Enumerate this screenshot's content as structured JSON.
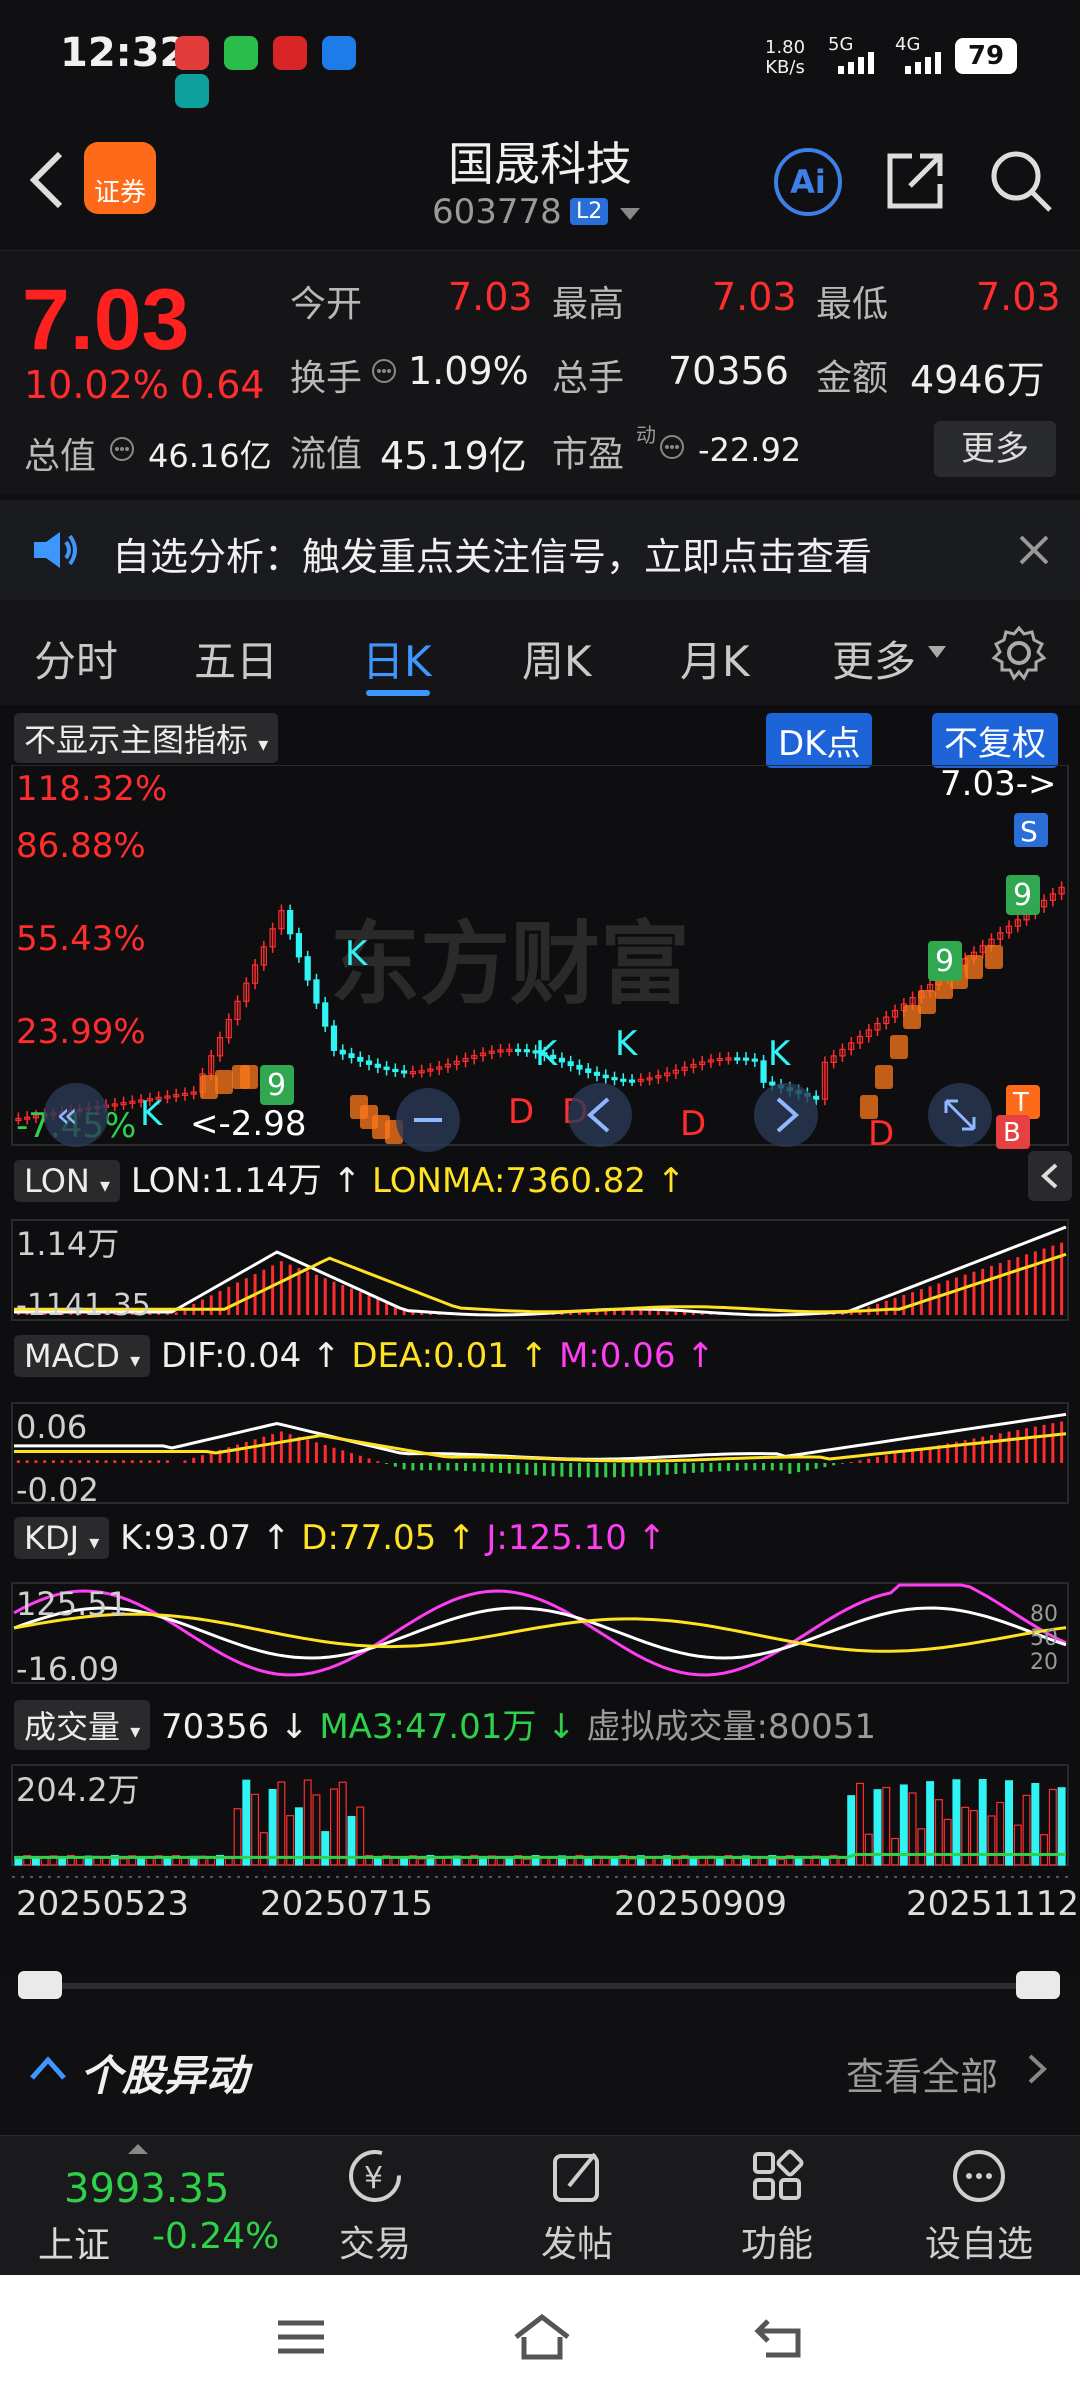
{
  "status": {
    "time": "12:32",
    "speed": "1.80",
    "speed_unit": "KB/s",
    "net1": "5G",
    "net2": "4G",
    "battery": "79"
  },
  "header": {
    "title": "国晟科技",
    "code": "603778",
    "level": "L2",
    "logo_text": "证券",
    "ai_label": "Ai"
  },
  "quote": {
    "price": "7.03",
    "change_pct": "10.02%",
    "change": "0.64",
    "open_label": "今开",
    "open": "7.03",
    "high_label": "最高",
    "high": "7.03",
    "low_label": "最低",
    "low": "7.03",
    "turnover_label": "换手",
    "turnover": "1.09%",
    "volume_label": "总手",
    "volume": "70356",
    "amount_label": "金额",
    "amount": "4946万",
    "mcap_label": "总值",
    "mcap": "46.16亿",
    "float_label": "流值",
    "float": "45.19亿",
    "pe_label": "市盈",
    "pe_sup": "动",
    "pe": "-22.92",
    "more_label": "更多"
  },
  "banner": {
    "text": "自选分析：触发重点关注信号，立即点击查看"
  },
  "tabs": {
    "t0": "分时",
    "t1": "五日",
    "t2": "日K",
    "t3": "周K",
    "t4": "月K",
    "t5": "更多"
  },
  "main_chart": {
    "indicator_select": "不显示主图指标",
    "dk_label": "DK点",
    "fq_label": "不复权",
    "scale": [
      "118.32%",
      "86.88%",
      "55.43%",
      "23.99%",
      "-7.45%"
    ],
    "last_price_marker": "7.03->",
    "low_marker": "<-2.98",
    "watermark": "东方财富",
    "k_label": "K",
    "d_label": "D",
    "s_label": "S",
    "t_label": "T",
    "b_label": "B",
    "nine_label": "9"
  },
  "lon": {
    "name": "LON",
    "value": "LON:1.14万",
    "ma": "LONMA:7360.82",
    "top": "1.14万",
    "bottom": "-1141.35"
  },
  "macd": {
    "name": "MACD",
    "dif": "DIF:0.04",
    "dea": "DEA:0.01",
    "m": "M:0.06",
    "top": "0.06",
    "bottom": "-0.02"
  },
  "kdj": {
    "name": "KDJ",
    "k": "K:93.07",
    "d": "D:77.05",
    "j": "J:125.10",
    "top": "125.51",
    "bottom": "-16.09",
    "r80": "80",
    "r50": "50",
    "r20": "20"
  },
  "vol": {
    "name": "成交量",
    "value": "70356",
    "ma": "MA3:47.01万",
    "virtual": "虚拟成交量:80051",
    "top": "204.2万"
  },
  "dates": [
    "20250523",
    "20250715",
    "20250909",
    "20251112"
  ],
  "section": {
    "title": "个股异动",
    "more": "查看全部"
  },
  "index": {
    "value": "3993.35",
    "name": "上证",
    "change": "-0.24%"
  },
  "bottom_nav": {
    "trade": "交易",
    "post": "发帖",
    "func": "功能",
    "watch": "设自选"
  },
  "colors": {
    "up": "#ff2d2d",
    "down": "#2fd14a",
    "accent": "#3e96ff",
    "yellow": "#ffe223",
    "magenta": "#ff3df2",
    "cyan": "#31f3f3"
  }
}
